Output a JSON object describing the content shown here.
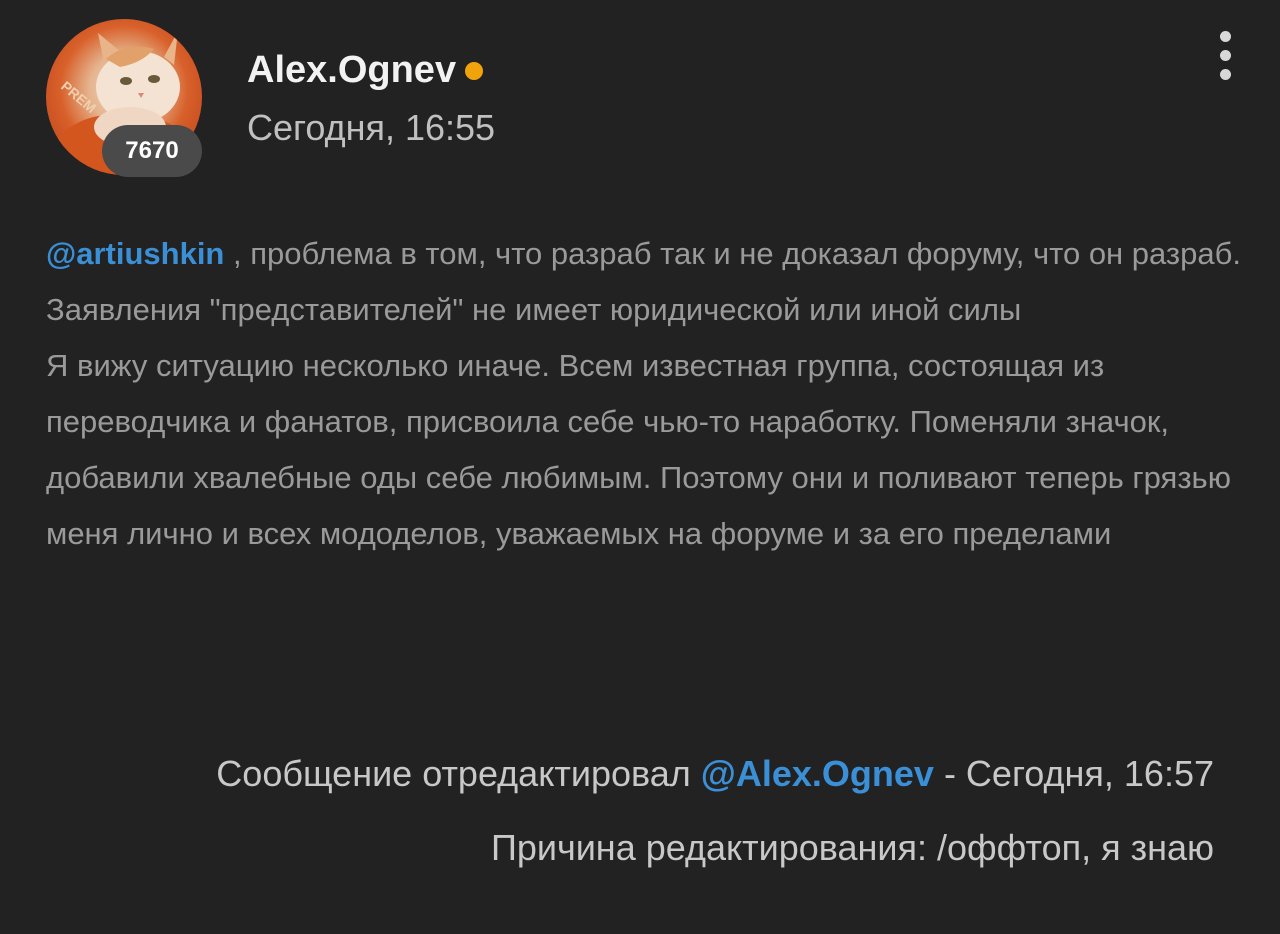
{
  "author": {
    "name": "Alex.Ognev",
    "reputation": "7670",
    "online": true,
    "online_color": "#f0a30a",
    "avatar_icon": "cat-avatar-icon"
  },
  "post": {
    "time": "Сегодня, 16:55",
    "mention": "@artiushkin",
    "paragraph1_rest": " , проблема в том, что разраб так и не доказал форуму, что он разраб. Заявления \"представителей\" не имеет юридической или иной силы",
    "paragraph2": "Я вижу ситуацию несколько иначе. Всем известная группа, состоящая из переводчика и фанатов, присвоила себе чью-то наработку. Поменяли значок, добавили хвалебные оды себе любимым. Поэтому они и поливают теперь грязью меня лично и всех мододелов, уважаемых на форуме и за его пределами"
  },
  "edit": {
    "prefix": "Сообщение отредактировал ",
    "editor": "@Alex.Ognev",
    "suffix": " - Сегодня, 16:57",
    "reason": "Причина редактирования: /оффтоп, я знаю"
  },
  "menu": {
    "icon": "more-vertical-icon"
  },
  "colors": {
    "background": "#222222",
    "link": "#3a8fd6",
    "body_text": "#9a9a9a"
  }
}
